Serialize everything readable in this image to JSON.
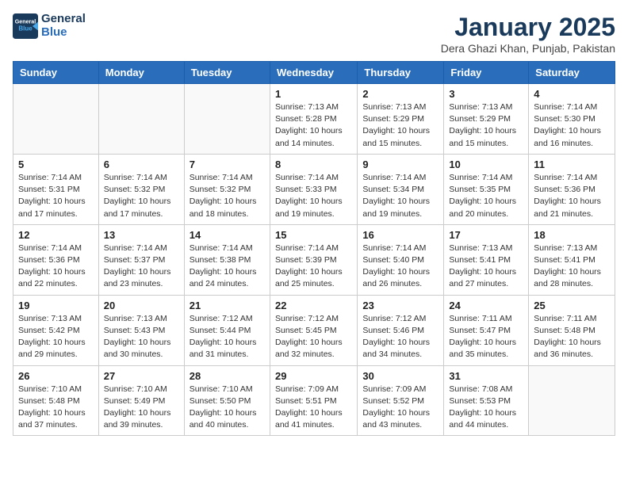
{
  "header": {
    "logo_line1": "General",
    "logo_line2": "Blue",
    "month": "January 2025",
    "location": "Dera Ghazi Khan, Punjab, Pakistan"
  },
  "weekdays": [
    "Sunday",
    "Monday",
    "Tuesday",
    "Wednesday",
    "Thursday",
    "Friday",
    "Saturday"
  ],
  "weeks": [
    [
      {
        "day": "",
        "info": ""
      },
      {
        "day": "",
        "info": ""
      },
      {
        "day": "",
        "info": ""
      },
      {
        "day": "1",
        "info": "Sunrise: 7:13 AM\nSunset: 5:28 PM\nDaylight: 10 hours and 14 minutes."
      },
      {
        "day": "2",
        "info": "Sunrise: 7:13 AM\nSunset: 5:29 PM\nDaylight: 10 hours and 15 minutes."
      },
      {
        "day": "3",
        "info": "Sunrise: 7:13 AM\nSunset: 5:29 PM\nDaylight: 10 hours and 15 minutes."
      },
      {
        "day": "4",
        "info": "Sunrise: 7:14 AM\nSunset: 5:30 PM\nDaylight: 10 hours and 16 minutes."
      }
    ],
    [
      {
        "day": "5",
        "info": "Sunrise: 7:14 AM\nSunset: 5:31 PM\nDaylight: 10 hours and 17 minutes."
      },
      {
        "day": "6",
        "info": "Sunrise: 7:14 AM\nSunset: 5:32 PM\nDaylight: 10 hours and 17 minutes."
      },
      {
        "day": "7",
        "info": "Sunrise: 7:14 AM\nSunset: 5:32 PM\nDaylight: 10 hours and 18 minutes."
      },
      {
        "day": "8",
        "info": "Sunrise: 7:14 AM\nSunset: 5:33 PM\nDaylight: 10 hours and 19 minutes."
      },
      {
        "day": "9",
        "info": "Sunrise: 7:14 AM\nSunset: 5:34 PM\nDaylight: 10 hours and 19 minutes."
      },
      {
        "day": "10",
        "info": "Sunrise: 7:14 AM\nSunset: 5:35 PM\nDaylight: 10 hours and 20 minutes."
      },
      {
        "day": "11",
        "info": "Sunrise: 7:14 AM\nSunset: 5:36 PM\nDaylight: 10 hours and 21 minutes."
      }
    ],
    [
      {
        "day": "12",
        "info": "Sunrise: 7:14 AM\nSunset: 5:36 PM\nDaylight: 10 hours and 22 minutes."
      },
      {
        "day": "13",
        "info": "Sunrise: 7:14 AM\nSunset: 5:37 PM\nDaylight: 10 hours and 23 minutes."
      },
      {
        "day": "14",
        "info": "Sunrise: 7:14 AM\nSunset: 5:38 PM\nDaylight: 10 hours and 24 minutes."
      },
      {
        "day": "15",
        "info": "Sunrise: 7:14 AM\nSunset: 5:39 PM\nDaylight: 10 hours and 25 minutes."
      },
      {
        "day": "16",
        "info": "Sunrise: 7:14 AM\nSunset: 5:40 PM\nDaylight: 10 hours and 26 minutes."
      },
      {
        "day": "17",
        "info": "Sunrise: 7:13 AM\nSunset: 5:41 PM\nDaylight: 10 hours and 27 minutes."
      },
      {
        "day": "18",
        "info": "Sunrise: 7:13 AM\nSunset: 5:41 PM\nDaylight: 10 hours and 28 minutes."
      }
    ],
    [
      {
        "day": "19",
        "info": "Sunrise: 7:13 AM\nSunset: 5:42 PM\nDaylight: 10 hours and 29 minutes."
      },
      {
        "day": "20",
        "info": "Sunrise: 7:13 AM\nSunset: 5:43 PM\nDaylight: 10 hours and 30 minutes."
      },
      {
        "day": "21",
        "info": "Sunrise: 7:12 AM\nSunset: 5:44 PM\nDaylight: 10 hours and 31 minutes."
      },
      {
        "day": "22",
        "info": "Sunrise: 7:12 AM\nSunset: 5:45 PM\nDaylight: 10 hours and 32 minutes."
      },
      {
        "day": "23",
        "info": "Sunrise: 7:12 AM\nSunset: 5:46 PM\nDaylight: 10 hours and 34 minutes."
      },
      {
        "day": "24",
        "info": "Sunrise: 7:11 AM\nSunset: 5:47 PM\nDaylight: 10 hours and 35 minutes."
      },
      {
        "day": "25",
        "info": "Sunrise: 7:11 AM\nSunset: 5:48 PM\nDaylight: 10 hours and 36 minutes."
      }
    ],
    [
      {
        "day": "26",
        "info": "Sunrise: 7:10 AM\nSunset: 5:48 PM\nDaylight: 10 hours and 37 minutes."
      },
      {
        "day": "27",
        "info": "Sunrise: 7:10 AM\nSunset: 5:49 PM\nDaylight: 10 hours and 39 minutes."
      },
      {
        "day": "28",
        "info": "Sunrise: 7:10 AM\nSunset: 5:50 PM\nDaylight: 10 hours and 40 minutes."
      },
      {
        "day": "29",
        "info": "Sunrise: 7:09 AM\nSunset: 5:51 PM\nDaylight: 10 hours and 41 minutes."
      },
      {
        "day": "30",
        "info": "Sunrise: 7:09 AM\nSunset: 5:52 PM\nDaylight: 10 hours and 43 minutes."
      },
      {
        "day": "31",
        "info": "Sunrise: 7:08 AM\nSunset: 5:53 PM\nDaylight: 10 hours and 44 minutes."
      },
      {
        "day": "",
        "info": ""
      }
    ]
  ]
}
